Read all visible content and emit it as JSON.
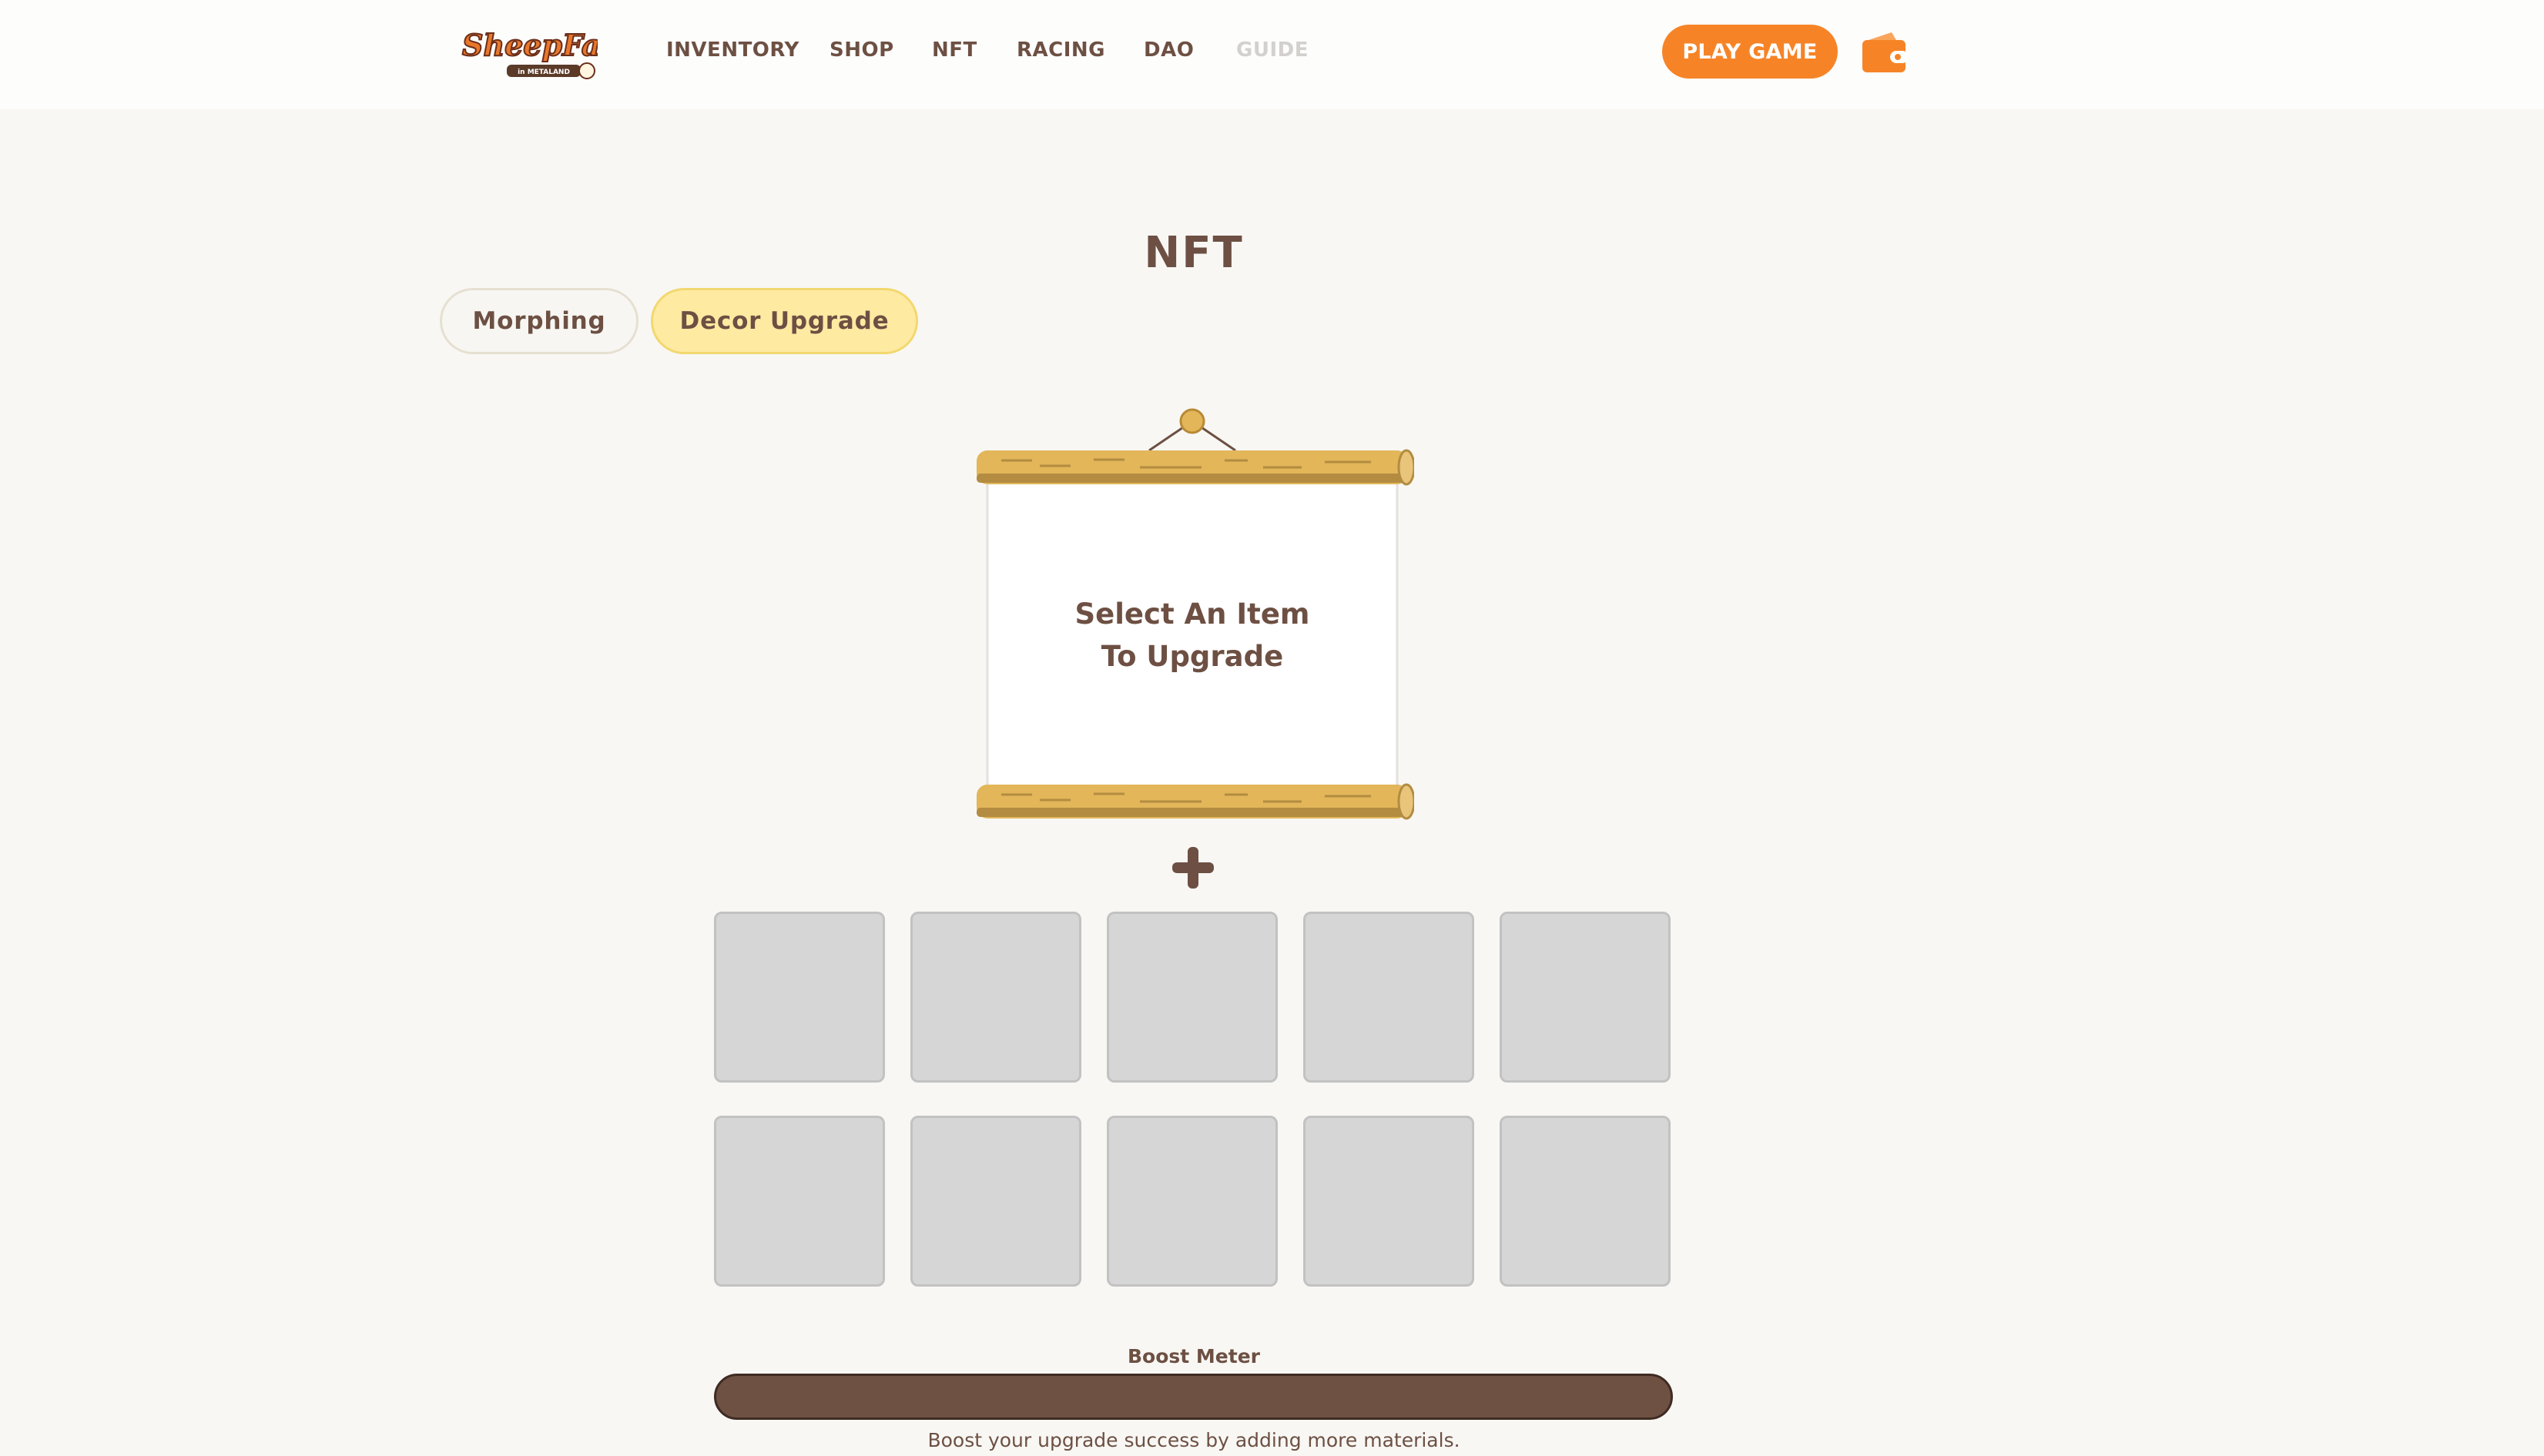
{
  "header": {
    "logo_text": "SheepFarm",
    "logo_subtext": "in METALAND",
    "nav": [
      {
        "label": "INVENTORY"
      },
      {
        "label": "SHOP"
      },
      {
        "label": "NFT"
      },
      {
        "label": "RACING"
      },
      {
        "label": "DAO"
      },
      {
        "label": "GUIDE",
        "disabled": true
      }
    ],
    "play_button": "PLAY GAME",
    "wallet_icon": "wallet-icon"
  },
  "main": {
    "title": "NFT",
    "tabs": [
      {
        "label": "Morphing",
        "active": false
      },
      {
        "label": "Decor Upgrade",
        "active": true
      }
    ],
    "scroll": {
      "line1": "Select An Item",
      "line2": "To Upgrade"
    },
    "plus_icon": "plus-icon",
    "material_slots": 10,
    "boost": {
      "label": "Boost Meter",
      "level": 0,
      "description": "Boost your upgrade success by adding more materials."
    }
  },
  "colors": {
    "accent": "#f68427",
    "text": "#6d5043",
    "tab_active": "#ffeaa2",
    "background": "#f8f7f4",
    "slot": "#d6d6d6",
    "boost_bar": "#6e5143"
  }
}
